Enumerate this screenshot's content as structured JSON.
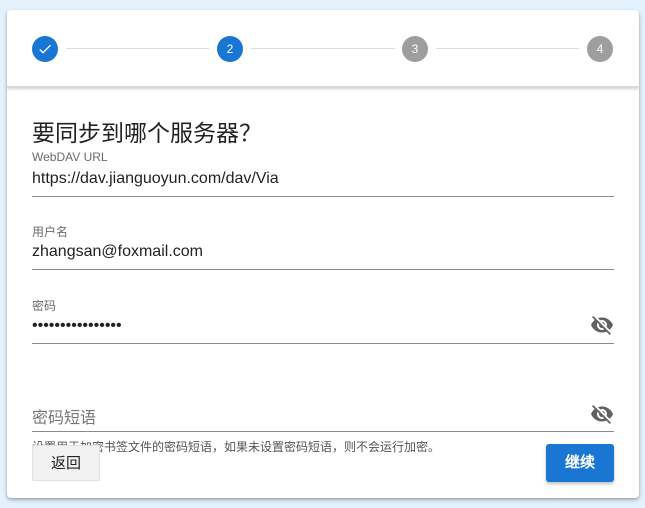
{
  "stepper": {
    "steps": [
      {
        "label": "",
        "state": "completed",
        "icon": "check-icon"
      },
      {
        "label": "2",
        "state": "active"
      },
      {
        "label": "3",
        "state": "inactive"
      },
      {
        "label": "4",
        "state": "inactive"
      }
    ]
  },
  "form": {
    "title": "要同步到哪个服务器？",
    "webdav_url": {
      "label": "WebDAV URL",
      "value": "https://dav.jianguoyun.com/dav/Via"
    },
    "username": {
      "label": "用户名",
      "value": "zhangsan@foxmail.com"
    },
    "password": {
      "label": "密码",
      "value": "••••••••••••••••",
      "toggle_icon": "eye-off-icon"
    },
    "passphrase": {
      "placeholder": "密码短语",
      "value": "",
      "toggle_icon": "eye-off-icon"
    },
    "helper_text": "设置用于加密书签文件的密码短语，如果未设置密码短语，则不会运行加密。"
  },
  "actions": {
    "back_label": "返回",
    "continue_label": "继续"
  },
  "colors": {
    "primary": "#1976d2",
    "inactive_step": "#9e9e9e",
    "background": "#e3f2fd"
  }
}
